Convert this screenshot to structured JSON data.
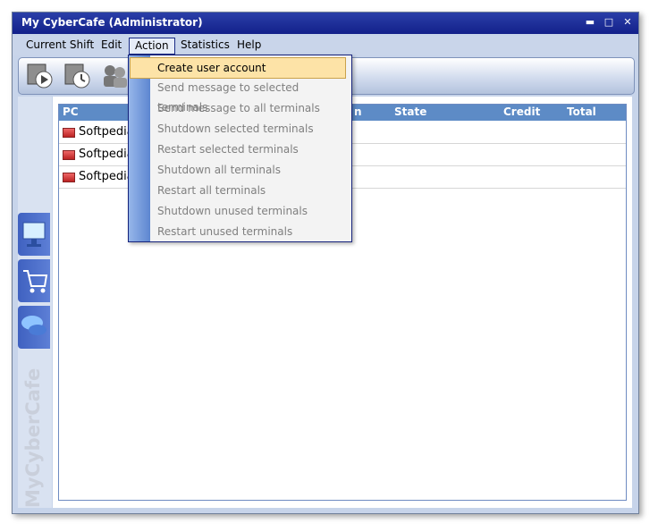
{
  "window": {
    "title": "My CyberCafe  (Administrator)",
    "min": "▬",
    "max": "□",
    "close": "✕"
  },
  "menubar": [
    "Current Shift",
    "Edit",
    "Action",
    "Statistics",
    "Help"
  ],
  "table": {
    "headers": [
      "PC",
      "n",
      "State",
      "Credit",
      "Total"
    ],
    "rows": [
      "Softpedia",
      "Softpedia",
      "Softpedia"
    ]
  },
  "sidebar": {
    "brand": "MyCyberCafe"
  },
  "action_menu": {
    "items": [
      "Create user account",
      "Send message to selected terminals",
      "Send message to all terminals",
      "Shutdown selected terminals",
      "Restart selected terminals",
      "Shutdown all terminals",
      "Restart all terminals",
      "Shutdown unused terminals",
      "Restart unused terminals"
    ]
  },
  "icons": {
    "toolbar": [
      "play-icon",
      "clock-icon",
      "users-icon"
    ],
    "sidebar": [
      "monitor-icon",
      "cart-icon",
      "chat-icon"
    ]
  }
}
